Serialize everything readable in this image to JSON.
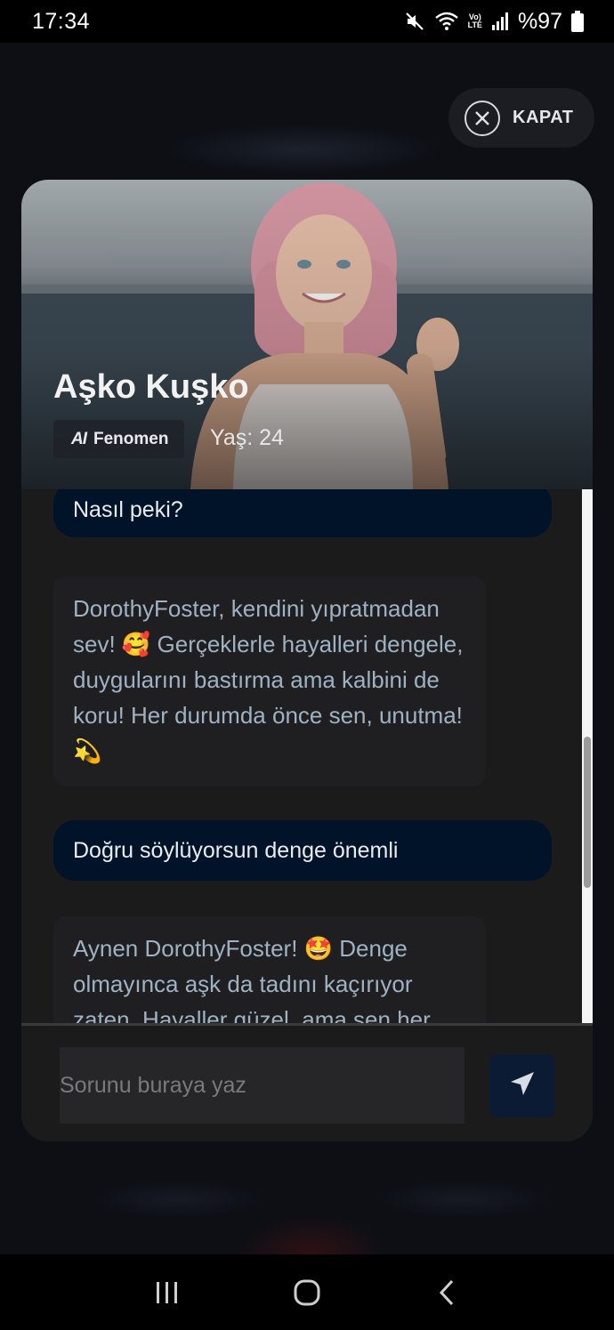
{
  "status_bar": {
    "time": "17:34",
    "lte_label_top": "Vo)",
    "lte_label_bottom": "LTE",
    "battery_text": "%97",
    "icons": [
      "mute-icon",
      "wifi-icon",
      "signal-icon",
      "battery-icon"
    ]
  },
  "close_button": {
    "label": "KAPAT",
    "icon": "close-icon"
  },
  "persona": {
    "name": "Aşko Kuşko",
    "tag_icon_text": "AI",
    "tag_label": "Fenomen",
    "age_text": "Yaş: 24"
  },
  "messages": [
    {
      "role": "user",
      "text": "Nasıl peki?"
    },
    {
      "role": "ai",
      "text": "DorothyFoster, kendini yıpratmadan sev! 🥰 Gerçeklerle hayalleri dengele, duygularını bastırma ama kalbini de koru! Her durumda önce sen, unutma! 💫"
    },
    {
      "role": "user",
      "text": "Doğru söylüyorsun denge önemli"
    },
    {
      "role": "ai",
      "text": "Aynen DorothyFoster! 🤩 Denge olmayınca aşk da tadını kaçırıyor zaten. Hayaller güzel, ama sen her"
    }
  ],
  "composer": {
    "placeholder": "Sorunu buraya yaz",
    "value": "",
    "send_icon": "send-icon"
  },
  "colors": {
    "user_bubble": "#011329",
    "ai_bubble": "#1f1f21",
    "ai_text": "#9fb2c4",
    "card_bg": "#1b1b1c",
    "send_button": "#0a1b33"
  },
  "nav_bar": {
    "icons": [
      "recent-apps-icon",
      "home-icon",
      "back-icon"
    ]
  }
}
